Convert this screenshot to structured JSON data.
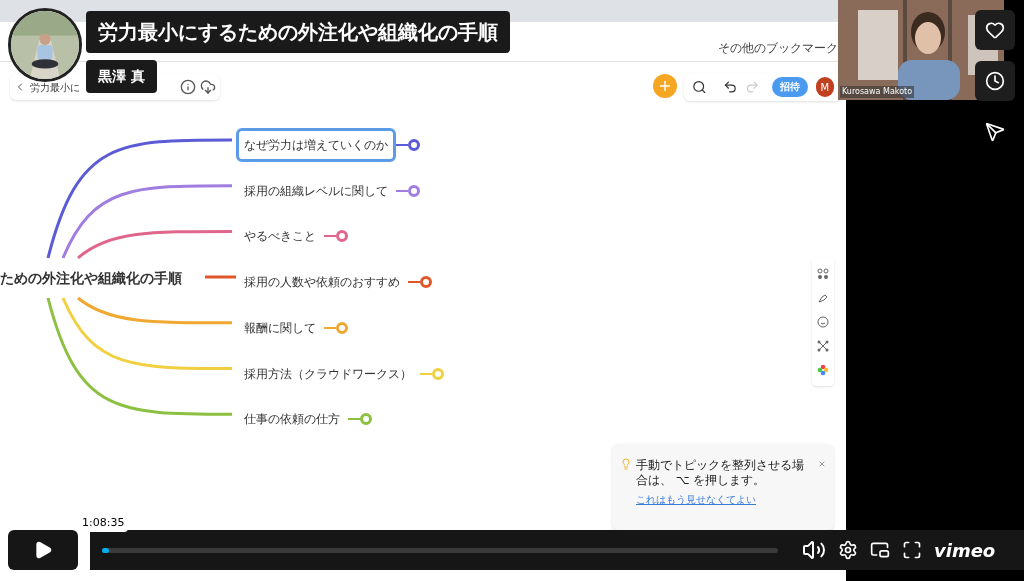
{
  "video": {
    "title": "労力最小にするための外注化や組織化の手順",
    "author": "黒澤 真",
    "time": "1:08:35",
    "progress": {
      "level": 0.01
    },
    "webcam_label": "Kurosawa Makoto",
    "logo": "vimeo"
  },
  "browser": {
    "bookmark": "その他のブックマーク"
  },
  "app": {
    "breadcrumb": "労力最小に",
    "invite": "招待",
    "avatar": "M"
  },
  "mindmap": {
    "root": "ための外注化や組織化の手順",
    "branches": [
      {
        "label": "なぜ労力は増えていくのか",
        "color": "#5b5bd6",
        "selected": true
      },
      {
        "label": "採用の組織レベルに関して",
        "color": "#a07de0",
        "selected": false
      },
      {
        "label": "やるべきこと",
        "color": "#e0668c",
        "selected": false
      },
      {
        "label": "採用の人数や依頼のおすすめ",
        "color": "#e0572a",
        "selected": false
      },
      {
        "label": "報酬に関して",
        "color": "#f0a830",
        "selected": false
      },
      {
        "label": "採用方法（クラウドワークス）",
        "color": "#f0d040",
        "selected": false
      },
      {
        "label": "仕事の依頼の仕方",
        "color": "#8cc040",
        "selected": false
      }
    ]
  },
  "toast": {
    "message": "手動でトピックを整列させる場合は、 ⌥ を押します。",
    "link": "これはもう見せなくてよい"
  }
}
